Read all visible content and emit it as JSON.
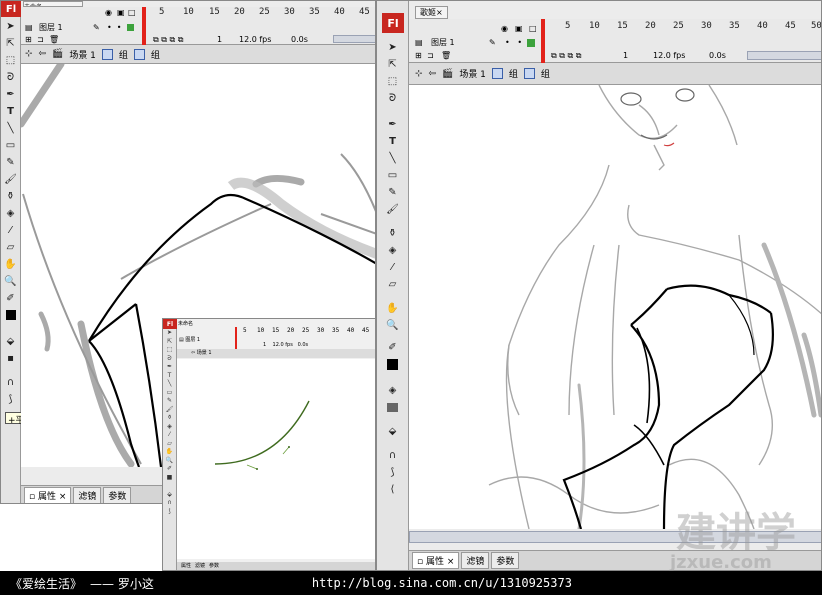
{
  "left_window": {
    "doc_tab": "未命名",
    "logo": "Fl",
    "layer_name": "图层 1",
    "frame_numbers": [
      "5",
      "10",
      "15",
      "20",
      "25",
      "30",
      "35",
      "40",
      "45"
    ],
    "frame": "1",
    "fps": "12.0 fps",
    "time": "0.0s",
    "breadcrumb": [
      "场景 1",
      "组",
      "组"
    ],
    "tooltip": "平滑",
    "panel_tabs": [
      "属性",
      "滤镜",
      "参数"
    ]
  },
  "mini_window": {
    "doc_tab": "未命名",
    "logo": "Fl",
    "layer_name": "图层 1",
    "frame_numbers": [
      "5",
      "10",
      "15",
      "20",
      "25",
      "30",
      "35",
      "40",
      "45"
    ],
    "frame": "1",
    "fps": "12.0 fps",
    "time": "0.0s",
    "breadcrumb": [
      "场景 1"
    ],
    "panel_tabs": [
      "属性",
      "滤镜",
      "参数"
    ]
  },
  "right_window": {
    "doc_tab": "歌姬",
    "logo": "Fl",
    "layer_name": "图层 1",
    "frame_numbers": [
      "5",
      "10",
      "15",
      "20",
      "25",
      "30",
      "35",
      "40",
      "45",
      "50"
    ],
    "frame": "1",
    "fps": "12.0 fps",
    "time": "0.0s",
    "breadcrumb": [
      "场景 1",
      "组",
      "组"
    ],
    "panel_tabs": [
      "属性",
      "滤镜",
      "参数"
    ]
  },
  "caption": {
    "title": "《爱绘生活》",
    "author": "—— 罗小这",
    "url": "http://blog.sina.com.cn/u/1310925373"
  },
  "watermark": {
    "line1": "建讲学",
    "line2": "jzxue.com"
  },
  "colors": {
    "logo_red": "#c8261f",
    "playhead_red": "#e2221a",
    "stage": "#ffffff",
    "chrome": "#ececec"
  }
}
